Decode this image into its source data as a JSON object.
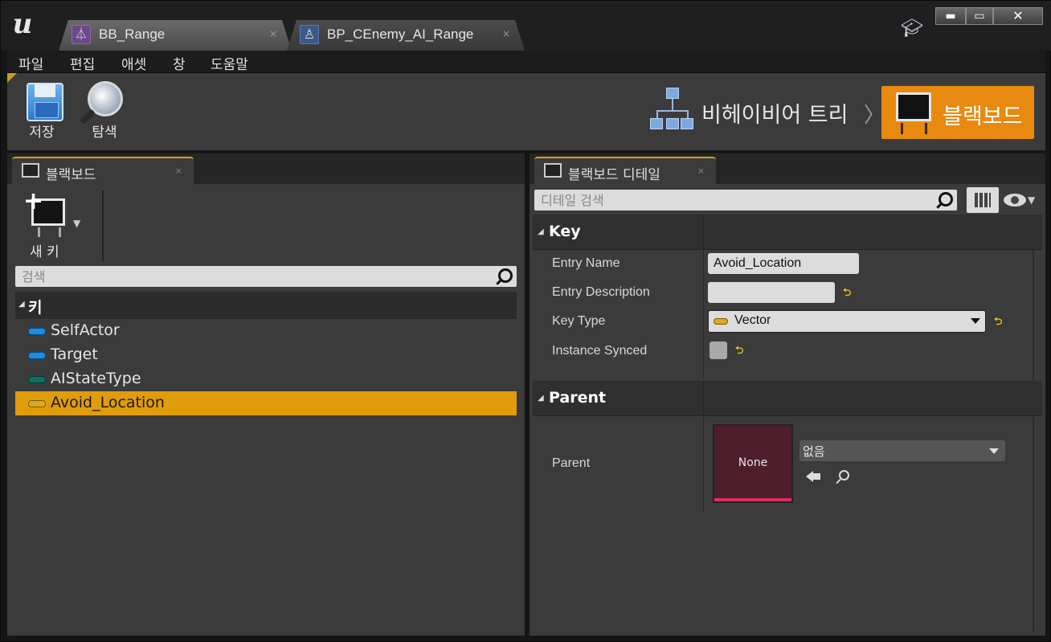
{
  "window": {
    "tabs": [
      {
        "label": "BB_Range",
        "close": "×"
      },
      {
        "label": "BP_CEnemy_AI_Range",
        "close": "×"
      }
    ],
    "controls": {
      "minimize": "▬",
      "maximize": "▭",
      "close": "✕"
    }
  },
  "menu": [
    "파일",
    "편집",
    "애셋",
    "창",
    "도움말"
  ],
  "toolbar": {
    "save_label": "저장",
    "browse_label": "탐색",
    "behavior_tree_label": "비헤이비어 트리",
    "crumb_separator": "〉",
    "blackboard_label": "블랙보드"
  },
  "left_panel": {
    "tab_label": "블랙보드",
    "tab_close": "×",
    "new_key_label": "새 키",
    "search_placeholder": "검색",
    "category_label": "키",
    "keys": [
      {
        "name": "SelfActor",
        "color": "#1a8ee0"
      },
      {
        "name": "Target",
        "color": "#1a8ee0"
      },
      {
        "name": "AIStateType",
        "color": "#0a7060"
      },
      {
        "name": "Avoid_Location",
        "color": "#e0a820",
        "selected": true
      }
    ]
  },
  "right_panel": {
    "tab_label": "블랙보드 디테일",
    "tab_close": "×",
    "search_placeholder": "디테일 검색",
    "sections": {
      "key": {
        "label": "Key",
        "entry_name_label": "Entry Name",
        "entry_name_value": "Avoid_Location",
        "entry_description_label": "Entry Description",
        "entry_description_value": "",
        "key_type_label": "Key Type",
        "key_type_value": "Vector",
        "instance_synced_label": "Instance Synced",
        "reset_glyph": "⮌"
      },
      "parent": {
        "label": "Parent",
        "parent_label": "Parent",
        "thumbnail_label": "None",
        "asset_value": "없음"
      }
    }
  },
  "colors": {
    "accent_orange": "#e88a10",
    "selection": "#e09c0a",
    "vector_pill": "#e0a820",
    "object_pill": "#1a8ee0",
    "enum_pill": "#0a7060"
  }
}
